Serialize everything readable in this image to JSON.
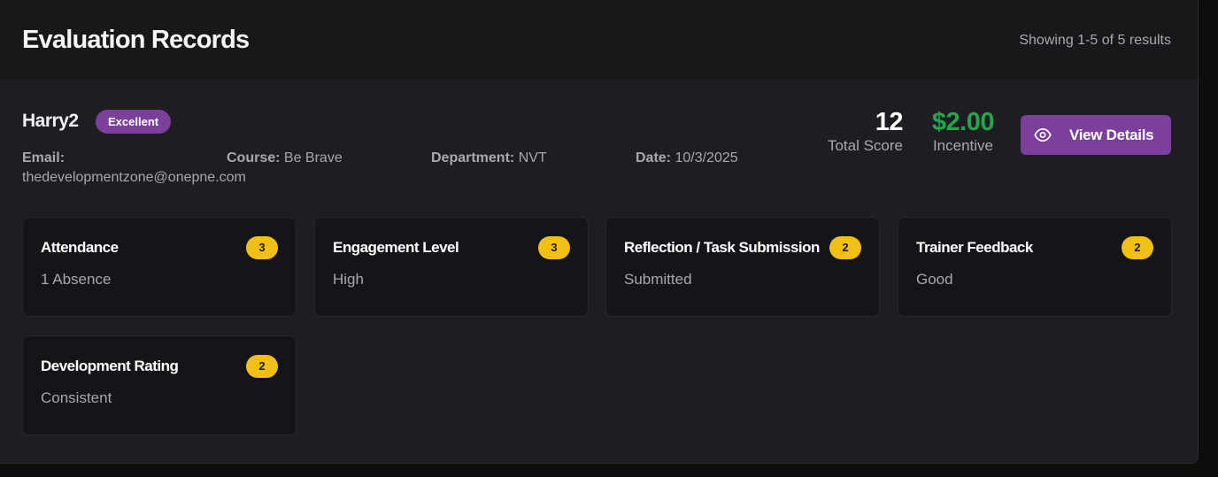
{
  "header": {
    "title": "Evaluation Records",
    "results_text": "Showing 1-5 of 5 results"
  },
  "record": {
    "name": "Harry2",
    "rating_badge": "Excellent",
    "email_label": "Email:",
    "email_value": "thedevelopmentzone@onepne.com",
    "course_label": "Course:",
    "course_value": "Be Brave",
    "department_label": "Department:",
    "department_value": "NVT",
    "date_label": "Date:",
    "date_value": "10/3/2025",
    "total_score_value": "12",
    "total_score_label": "Total Score",
    "incentive_value": "$2.00",
    "incentive_label": "Incentive",
    "view_details_label": "View Details",
    "view_details_icon": "eye-icon",
    "criteria": [
      {
        "name": "Attendance",
        "score": "3",
        "value": "1 Absence"
      },
      {
        "name": "Engagement Level",
        "score": "3",
        "value": "High"
      },
      {
        "name": "Reflection / Task Submission",
        "score": "2",
        "value": "Submitted"
      },
      {
        "name": "Trainer Feedback",
        "score": "2",
        "value": "Good"
      },
      {
        "name": "Development Rating",
        "score": "2",
        "value": "Consistent"
      }
    ]
  },
  "colors": {
    "accent_purple": "#7b3f9c",
    "incentive_green": "#22a84a",
    "score_badge_yellow": "#f2c014",
    "panel_bg": "#1e1d22",
    "card_bg": "#151418"
  }
}
